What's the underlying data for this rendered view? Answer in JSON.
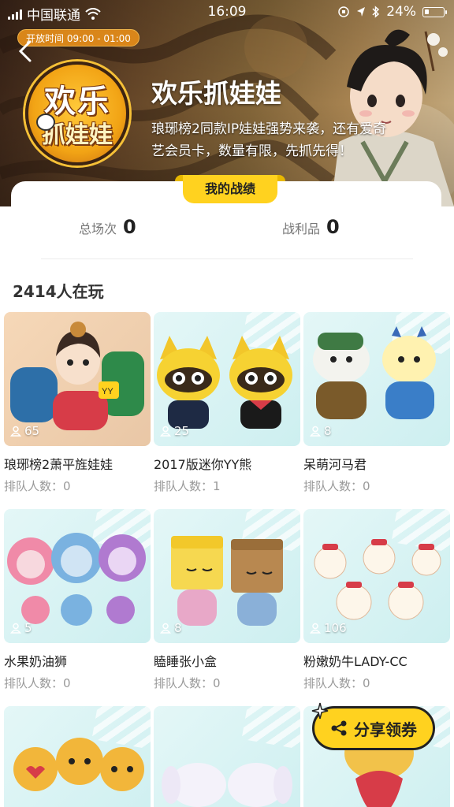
{
  "status_bar": {
    "carrier": "中国联通",
    "time": "16:09",
    "battery": "24%"
  },
  "banner": {
    "open_hours": "开放时间 09:00 - 01:00",
    "logo_line1": "欢乐",
    "logo_line2": "抓娃娃",
    "title": "欢乐抓娃娃",
    "description": "琅琊榜2同款IP娃娃强势来袭，还有爱奇艺会员卡，数量有限，先抓先得！"
  },
  "stats": {
    "tab_label": "我的战绩",
    "total_label": "总场次",
    "total_value": "0",
    "loot_label": "战利品",
    "loot_value": "0"
  },
  "players_online": "2414人在玩",
  "products": [
    {
      "name": "琅琊榜2萧平旌娃娃",
      "count": "65",
      "queue": "排队人数：0"
    },
    {
      "name": "2017版迷你YY熊",
      "count": "25",
      "queue": "排队人数：1"
    },
    {
      "name": "呆萌河马君",
      "count": "8",
      "queue": "排队人数：0"
    },
    {
      "name": "水果奶油狮",
      "count": "5",
      "queue": "排队人数：0"
    },
    {
      "name": "瞌睡张小盒",
      "count": "8",
      "queue": "排队人数：0"
    },
    {
      "name": "粉嫩奶牛LADY-CC",
      "count": "106",
      "queue": "排队人数：0"
    },
    {
      "name": "",
      "count": "",
      "queue": ""
    },
    {
      "name": "",
      "count": "",
      "queue": ""
    },
    {
      "name": "",
      "count": "",
      "queue": ""
    }
  ],
  "share_button": "分享领券",
  "colors": {
    "accent_yellow": "#ffd21f",
    "text_dark": "#222222",
    "text_muted": "#999999"
  }
}
